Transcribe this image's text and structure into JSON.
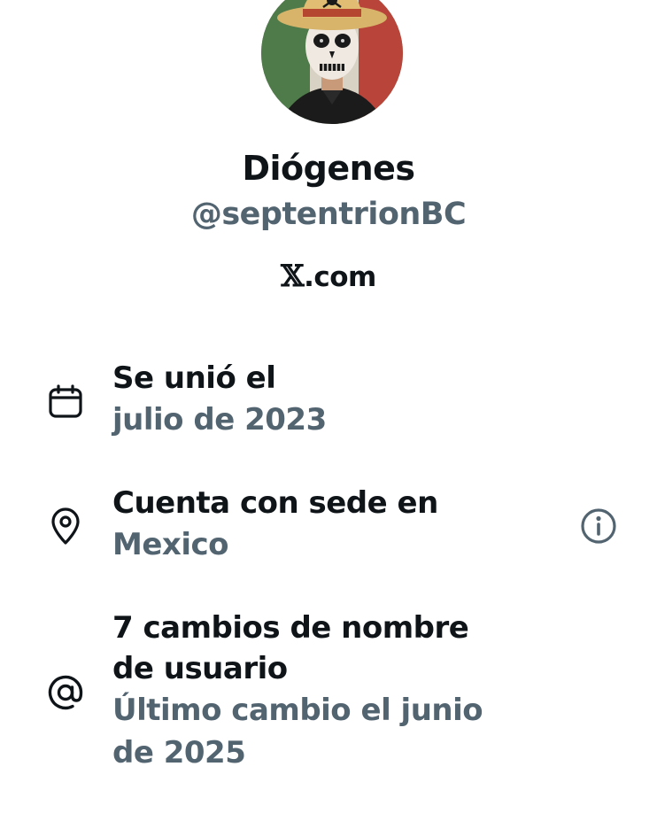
{
  "profile": {
    "display_name": "Diógenes",
    "handle": "@septentrionBC",
    "site_prefix": "𝕏",
    "site_suffix": ".com"
  },
  "about": {
    "joined": {
      "icon": "calendar-icon",
      "title": "Se unió el",
      "value": "julio de 2023"
    },
    "location": {
      "icon": "location-pin-icon",
      "title": "Cuenta con sede en",
      "value": "Mexico",
      "info_icon": "info-icon"
    },
    "username_changes": {
      "icon": "at-sign-icon",
      "title_line1": "7 cambios de nombre",
      "title_line2": "de usuario",
      "value_line1": "Último cambio el junio",
      "value_line2": "de 2025"
    }
  },
  "colors": {
    "text_primary": "#0f1419",
    "text_secondary": "#536471",
    "background": "#ffffff"
  }
}
